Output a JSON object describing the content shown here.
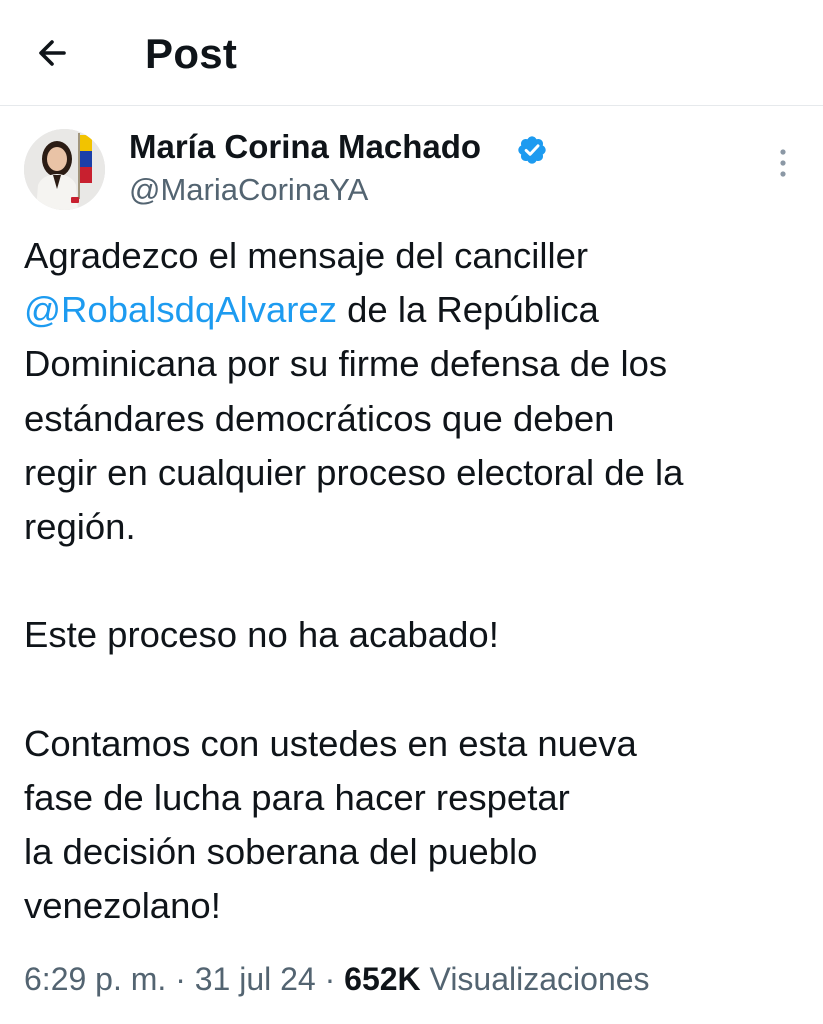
{
  "header": {
    "back_icon": "arrow-left-icon",
    "title": "Post"
  },
  "author": {
    "name": "María Corina Machado",
    "handle": "@MariaCorinaYA",
    "verified_icon": "verified-badge-icon",
    "verified_color": "#1d9bf0",
    "avatar": "avatar"
  },
  "more_icon": "more-vertical-icon",
  "post": {
    "paragraph1": {
      "line1": "Agradezco el mensaje del canciller",
      "mention": "@RobalsdqAlvarez",
      "line2_rest": " de la República",
      "line3": "Dominicana por su firme defensa de los",
      "line4": "estándares democráticos que deben",
      "line5": "regir en cualquier proceso electoral de la",
      "line6": "región."
    },
    "paragraph2": {
      "line1": "Este proceso no ha acabado!"
    },
    "paragraph3": {
      "line1": "Contamos con ustedes en esta nueva",
      "line2": "fase de lucha para hacer respetar",
      "line3": "la decisión soberana del pueblo",
      "line4": "venezolano!"
    }
  },
  "meta": {
    "time": "6:29 p. m.",
    "separator": " · ",
    "date": "31 jul 24",
    "views_count": "652K",
    "views_label": " Visualizaciones"
  },
  "colors": {
    "text": "#0f1419",
    "secondary": "#536471",
    "link": "#1d9bf0",
    "divider": "#e6e9ec"
  }
}
